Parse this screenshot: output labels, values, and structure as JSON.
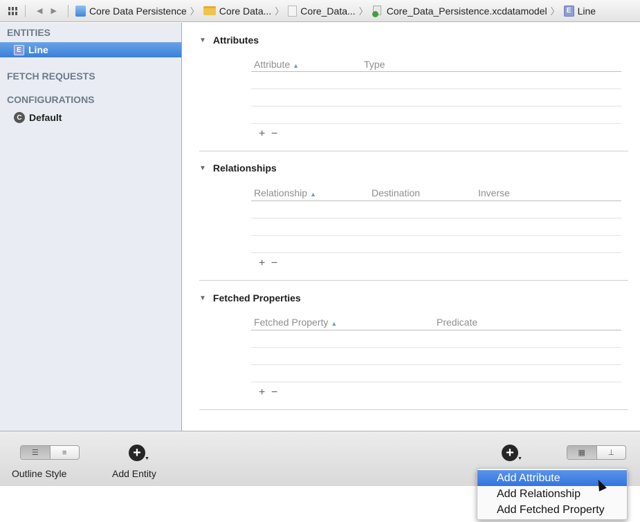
{
  "jumpbar": {
    "segments": [
      "Core Data Persistence",
      "Core Data...",
      "Core_Data...",
      "Core_Data_Persistence.xcdatamodel",
      "Line"
    ],
    "entity_badge": "E"
  },
  "sidebar": {
    "entities_header": "ENTITIES",
    "entity_item": "Line",
    "entity_badge": "E",
    "fetch_requests_header": "FETCH REQUESTS",
    "configurations_header": "CONFIGURATIONS",
    "configuration_item": "Default",
    "configuration_badge": "C"
  },
  "attributes": {
    "title": "Attributes",
    "columns": [
      "Attribute",
      "Type"
    ]
  },
  "relationships": {
    "title": "Relationships",
    "columns": [
      "Relationship",
      "Destination",
      "Inverse"
    ]
  },
  "fetched_properties": {
    "title": "Fetched Properties",
    "columns": [
      "Fetched Property",
      "Predicate"
    ]
  },
  "bottombar": {
    "outline_style_label": "Outline Style",
    "add_entity_label": "Add Entity"
  },
  "add_menu": {
    "items": [
      "Add Attribute",
      "Add Relationship",
      "Add Fetched Property"
    ],
    "highlighted": "Add Attribute"
  },
  "colors": {
    "selection": "#3a7fd8",
    "sidebar_bg": "#e9edf3",
    "menu_highlight": "#3375de"
  }
}
